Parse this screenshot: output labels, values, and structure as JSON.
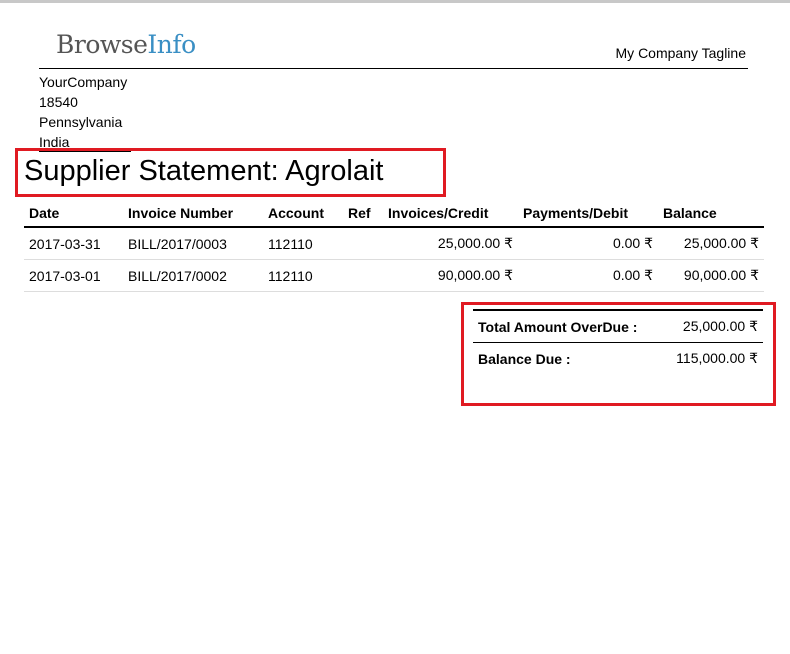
{
  "company": {
    "logo_part1": "Browse",
    "logo_part2": "Info",
    "tagline": "My Company Tagline",
    "address": [
      "YourCompany",
      "18540",
      "Pennsylvania",
      "India"
    ]
  },
  "statement": {
    "title": "Supplier Statement: Agrolait"
  },
  "table": {
    "headers": [
      "Date",
      "Invoice Number",
      "Account",
      "Ref",
      "Invoices/Credit",
      "Payments/Debit",
      "Balance"
    ],
    "rows": [
      [
        "2017-03-31",
        "BILL/2017/0003",
        "112110",
        "",
        "25,000.00 ₹",
        "0.00 ₹",
        "25,000.00 ₹"
      ],
      [
        "2017-03-01",
        "BILL/2017/0002",
        "112110",
        "",
        "90,000.00 ₹",
        "0.00 ₹",
        "90,000.00 ₹"
      ]
    ]
  },
  "totals": {
    "overdue_label": "Total Amount OverDue :",
    "overdue_value": "25,000.00 ₹",
    "balance_label": "Balance Due :",
    "balance_value": "115,000.00 ₹"
  },
  "colors": {
    "highlight": "#e01a22",
    "logo_gray": "#555555",
    "logo_blue": "#3a8fc4"
  }
}
